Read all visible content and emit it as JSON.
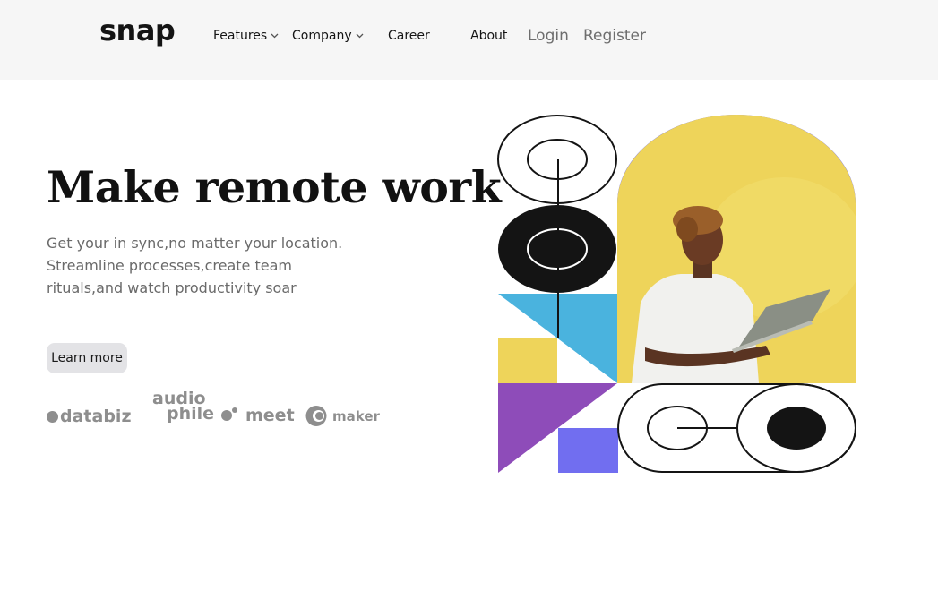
{
  "brand": {
    "logo": "snap"
  },
  "nav": {
    "features": "Features",
    "company": "Company",
    "career": "Career",
    "about": "About"
  },
  "auth": {
    "login": "Login",
    "register": "Register"
  },
  "hero": {
    "title": "Make remote work",
    "subtitle_lines": [
      "Get your in sync,no matter your location.",
      "Streamline processes,create team",
      "rituals,and watch productivity soar"
    ],
    "cta": "Learn more"
  },
  "clients": {
    "databiz": "databiz",
    "audio": "audio",
    "phile": "phile",
    "meet": "meet",
    "maker": "maker"
  },
  "colors": {
    "header_bg": "#f6f6f6",
    "purple_blue": "#716ef0",
    "yellow": "#eed45a",
    "cyan": "#4ab3de",
    "violet": "#8e4cb9",
    "black": "#141414",
    "logo_gray": "#8e8e8e"
  },
  "icons": {
    "chevron": "chevron-down-icon",
    "logo_dots": "dot-icon"
  }
}
